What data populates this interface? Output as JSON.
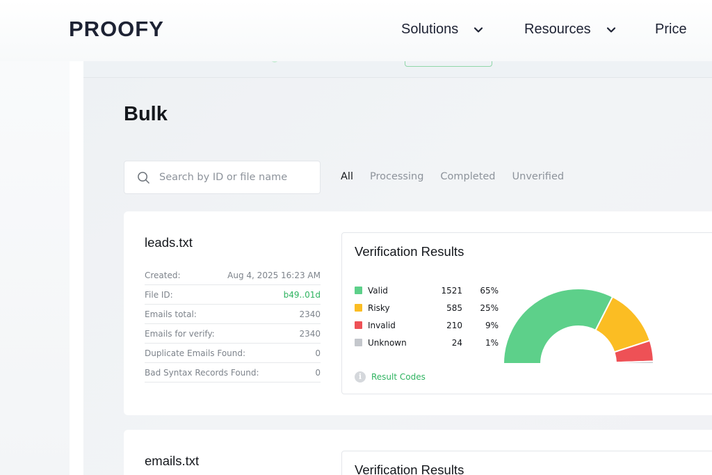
{
  "nav": {
    "logo": "PROOFY",
    "items": [
      {
        "label": "Solutions",
        "has_dropdown": true
      },
      {
        "label": "Resources",
        "has_dropdown": true
      },
      {
        "label": "Price",
        "has_dropdown": false
      }
    ]
  },
  "page": {
    "title": "Bulk",
    "search_placeholder": "Search by ID or file name",
    "tabs": [
      "All",
      "Processing",
      "Completed",
      "Unverified"
    ],
    "active_tab": "All"
  },
  "files": [
    {
      "name": "leads.txt",
      "meta": [
        {
          "label": "Created:",
          "value": "Aug 4, 2025 16:23 AM"
        },
        {
          "label": "File ID:",
          "value": "b49..01d"
        },
        {
          "label": "Emails total:",
          "value": "2340"
        },
        {
          "label": "Emails for verify:",
          "value": "2340"
        },
        {
          "label": "Duplicate Emails Found:",
          "value": "0"
        },
        {
          "label": "Bad Syntax Records Found:",
          "value": "0"
        }
      ],
      "results_title": "Verification Results",
      "results": [
        {
          "name": "Valid",
          "count": "1521",
          "pct": "65%",
          "color": "#5dd08a"
        },
        {
          "name": "Risky",
          "count": "585",
          "pct": "25%",
          "color": "#fbbd23"
        },
        {
          "name": "Invalid",
          "count": "210",
          "pct": "9%",
          "color": "#ee5156"
        },
        {
          "name": "Unknown",
          "count": "24",
          "pct": "1%",
          "color": "#c4c7cc"
        }
      ],
      "result_codes_label": "Result Codes"
    },
    {
      "name": "emails.txt",
      "results_title": "Verification Results"
    }
  ],
  "colors": {
    "accent_green": "#2fb360",
    "text_dark": "#14171c",
    "muted": "#8d939b"
  },
  "chart_data": {
    "type": "pie",
    "categories": [
      "Valid",
      "Risky",
      "Invalid",
      "Unknown"
    ],
    "values": [
      1521,
      585,
      210,
      24
    ],
    "percent": [
      65,
      25,
      9,
      1
    ]
  }
}
